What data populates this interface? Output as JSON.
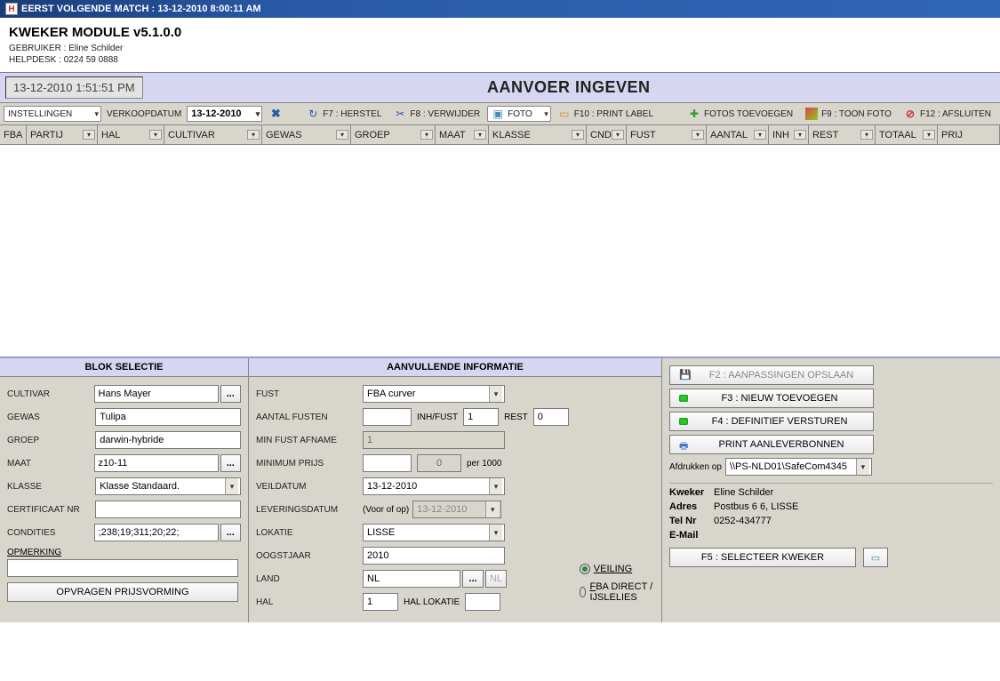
{
  "titlebar": "EERST VOLGENDE MATCH : 13-12-2010 8:00:11 AM",
  "header": {
    "title": "KWEKER MODULE v5.1.0.0",
    "user_label": "GEBRUIKER : Eline Schilder",
    "helpdesk_label": "HELPDESK : 0224 59 0888"
  },
  "clock": "13-12-2010 1:51:51 PM",
  "page_title": "AANVOER INGEVEN",
  "toolbar": {
    "instellingen": "INSTELLINGEN",
    "verkoopdatum_label": "VERKOOPDATUM",
    "verkoopdatum_value": "13-12-2010",
    "f7": "F7 : HERSTEL",
    "f8": "F8 : VERWIJDER",
    "foto": "FOTO",
    "f10": "F10 : PRINT LABEL",
    "fotos_toevoegen": "FOTOS TOEVOEGEN",
    "f9": "F9 : TOON FOTO",
    "f12": "F12 : AFSLUITEN"
  },
  "grid_headers": [
    "FBA",
    "PARTIJ",
    "HAL",
    "CULTIVAR",
    "GEWAS",
    "GROEP",
    "MAAT",
    "KLASSE",
    "CND",
    "FUST",
    "AANTAL",
    "INH",
    "REST",
    "TOTAAL",
    "PRIJ"
  ],
  "blok": {
    "title": "BLOK SELECTIE",
    "cultivar_label": "CULTIVAR",
    "cultivar_value": "Hans Mayer",
    "gewas_label": "GEWAS",
    "gewas_value": "Tulipa",
    "groep_label": "GROEP",
    "groep_value": "darwin-hybride",
    "maat_label": "MAAT",
    "maat_value": "z10-11",
    "klasse_label": "KLASSE",
    "klasse_value": "Klasse Standaard.",
    "certificaat_label": "CERTIFICAAT NR",
    "certificaat_value": "",
    "condities_label": "CONDITIES",
    "condities_value": ";238;19;311;20;22;",
    "opmerking_label": "OPMERKING",
    "opmerking_value": "",
    "opvragen_btn": "OPVRAGEN PRIJSVORMING"
  },
  "aanvullende": {
    "title": "AANVULLENDE INFORMATIE",
    "fust_label": "FUST",
    "fust_value": "FBA curver",
    "aantal_fusten_label": "AANTAL FUSTEN",
    "aantal_fusten_value": "",
    "inh_fust_label": "INH/FUST",
    "inh_fust_value": "1",
    "rest_label": "REST",
    "rest_value": "0",
    "min_fust_afname_label": "MIN FUST AFNAME",
    "min_fust_afname_value": "1",
    "minimum_prijs_label": "MINIMUM PRIJS",
    "minimum_prijs_value": "",
    "minimum_prijs_value2": "0",
    "per_1000": "per 1000",
    "veildatum_label": "VEILDATUM",
    "veildatum_value": "13-12-2010",
    "leveringsdatum_label": "LEVERINGSDATUM",
    "leveringsdatum_text": "(Voor of op)",
    "leveringsdatum_value": "13-12-2010",
    "lokatie_label": "LOKATIE",
    "lokatie_value": "LISSE",
    "oogstjaar_label": "OOGSTJAAR",
    "oogstjaar_value": "2010",
    "land_label": "LAND",
    "land_value": "NL",
    "land_code": "NL",
    "hal_label": "HAL",
    "hal_value": "1",
    "hal_lokatie_label": "HAL LOKATIE",
    "hal_lokatie_value": "",
    "radio_veiling": "VEILING",
    "radio_fba": "FBA DIRECT / IJSLELIES"
  },
  "right": {
    "f2": "F2 : AANPASSINGEN OPSLAAN",
    "f3": "F3 : NIEUW TOEVOEGEN",
    "f4": "F4 : DEFINITIEF VERSTUREN",
    "print": "PRINT AANLEVERBONNEN",
    "afdrukken_label": "Afdrukken op",
    "printer_value": "\\\\PS-NLD01\\SafeCom4345",
    "kweker_label": "Kweker",
    "kweker_value": "Eline Schilder",
    "adres_label": "Adres",
    "adres_value": "Postbus 6 6, LISSE",
    "tel_label": "Tel Nr",
    "tel_value": "0252-434777",
    "email_label": "E-Mail",
    "email_value": "",
    "f5": "F5 : SELECTEER KWEKER"
  }
}
